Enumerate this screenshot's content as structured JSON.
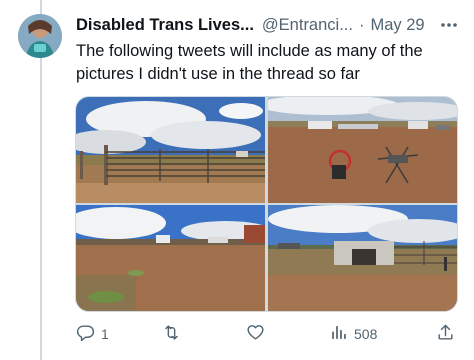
{
  "tweet": {
    "author_name": "Disabled Trans Lives...",
    "author_handle": "@Entranci...",
    "separator": "·",
    "date": "May 29",
    "text": "The following tweets will include as many of the pictures I didn't use in the thread so far"
  },
  "actions": {
    "replies": "1",
    "views": "508"
  },
  "icons": {
    "more": "more-icon",
    "reply": "reply-icon",
    "retweet": "retweet-icon",
    "like": "heart-icon",
    "views": "views-icon",
    "share": "share-icon"
  },
  "colors": {
    "text": "#0f1419",
    "secondary": "#536471",
    "border": "#cfd9de",
    "sky": "#3f74c4",
    "dirt": "#9b6a4a"
  }
}
